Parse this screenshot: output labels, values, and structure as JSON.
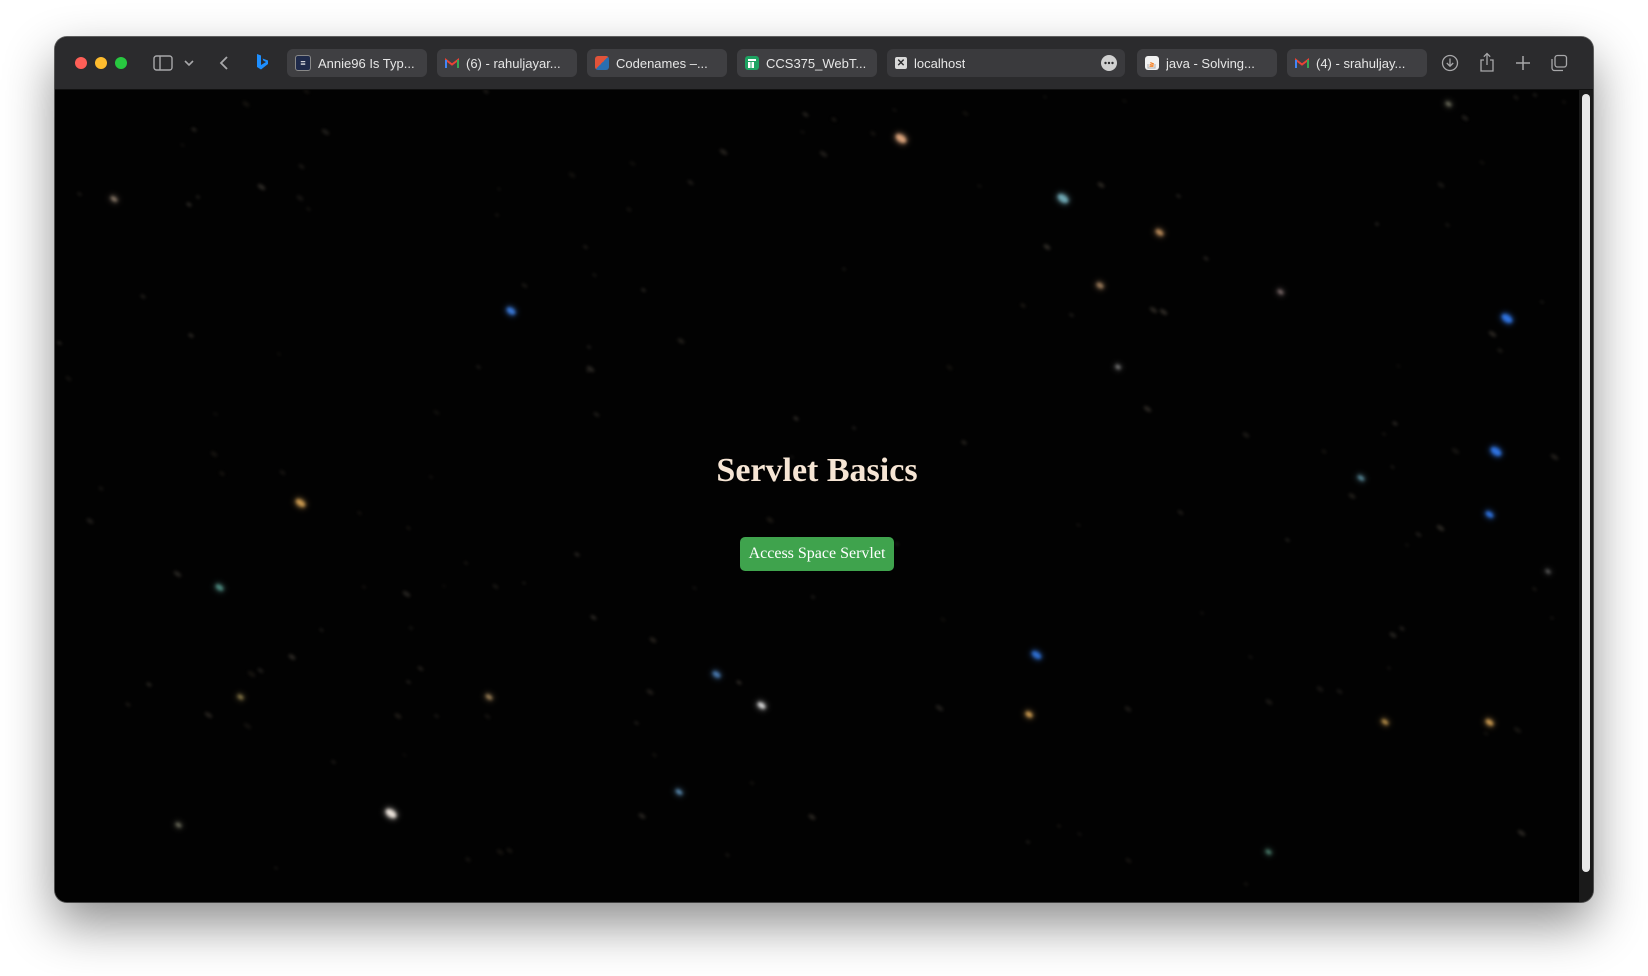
{
  "browser": {
    "tabs": [
      {
        "label": "Annie96 Is Typ...",
        "favicon": "dark-doc-icon"
      },
      {
        "label": "(6) - rahuljayar...",
        "favicon": "gmail-icon"
      },
      {
        "label": "Codenames –...",
        "favicon": "codenames-icon"
      },
      {
        "label": "CCS375_WebT...",
        "favicon": "sheets-icon"
      },
      {
        "label": "localhost",
        "favicon": "close-icon",
        "active": true
      },
      {
        "label": "java - Solving...",
        "favicon": "stackoverflow-icon"
      },
      {
        "label": "(4) - srahuljay...",
        "favicon": "gmail-icon"
      }
    ]
  },
  "page": {
    "heading": "Servlet Basics",
    "button_label": "Access Space Servlet",
    "background": "#020202",
    "heading_color": "#f6e5d4",
    "button_color": "#3fa34d"
  }
}
